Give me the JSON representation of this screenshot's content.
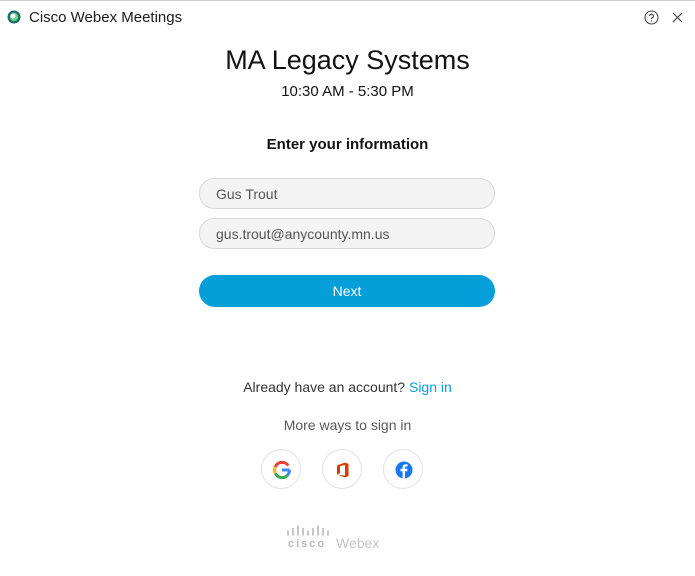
{
  "app": {
    "title": "Cisco Webex Meetings"
  },
  "meeting": {
    "title": "MA Legacy Systems",
    "time": "10:30 AM - 5:30 PM"
  },
  "form": {
    "heading": "Enter your information",
    "name_value": "Gus Trout",
    "email_value": "gus.trout@anycounty.mn.us",
    "next_label": "Next"
  },
  "account": {
    "prompt": "Already have an account?",
    "sign_in_label": "Sign in",
    "more_ways": "More ways to sign in"
  },
  "social": [
    {
      "name": "google",
      "icon": "google-icon"
    },
    {
      "name": "office",
      "icon": "office-icon"
    },
    {
      "name": "facebook",
      "icon": "facebook-icon"
    }
  ],
  "footer": {
    "cisco": "cisco",
    "product": "Webex"
  },
  "colors": {
    "accent": "#049fd9",
    "office": "#d83b01",
    "facebook": "#1877f2"
  }
}
